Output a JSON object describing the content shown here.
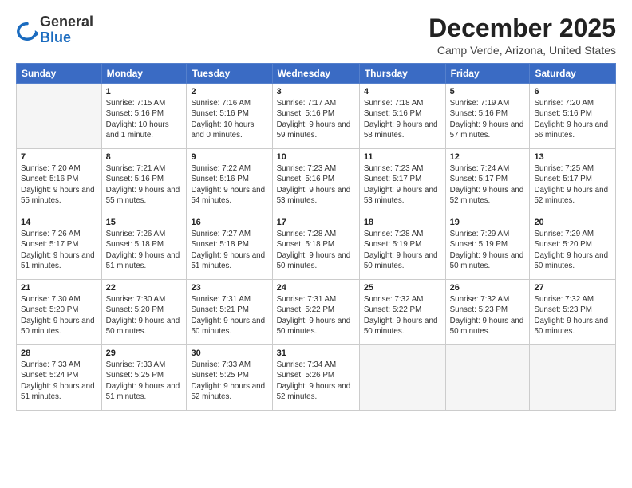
{
  "logo": {
    "general": "General",
    "blue": "Blue"
  },
  "title": "December 2025",
  "location": "Camp Verde, Arizona, United States",
  "days_of_week": [
    "Sunday",
    "Monday",
    "Tuesday",
    "Wednesday",
    "Thursday",
    "Friday",
    "Saturday"
  ],
  "weeks": [
    [
      {
        "day": "",
        "info": ""
      },
      {
        "day": "1",
        "info": "Sunrise: 7:15 AM\nSunset: 5:16 PM\nDaylight: 10 hours\nand 1 minute."
      },
      {
        "day": "2",
        "info": "Sunrise: 7:16 AM\nSunset: 5:16 PM\nDaylight: 10 hours\nand 0 minutes."
      },
      {
        "day": "3",
        "info": "Sunrise: 7:17 AM\nSunset: 5:16 PM\nDaylight: 9 hours\nand 59 minutes."
      },
      {
        "day": "4",
        "info": "Sunrise: 7:18 AM\nSunset: 5:16 PM\nDaylight: 9 hours\nand 58 minutes."
      },
      {
        "day": "5",
        "info": "Sunrise: 7:19 AM\nSunset: 5:16 PM\nDaylight: 9 hours\nand 57 minutes."
      },
      {
        "day": "6",
        "info": "Sunrise: 7:20 AM\nSunset: 5:16 PM\nDaylight: 9 hours\nand 56 minutes."
      }
    ],
    [
      {
        "day": "7",
        "info": "Sunrise: 7:20 AM\nSunset: 5:16 PM\nDaylight: 9 hours\nand 55 minutes."
      },
      {
        "day": "8",
        "info": "Sunrise: 7:21 AM\nSunset: 5:16 PM\nDaylight: 9 hours\nand 55 minutes."
      },
      {
        "day": "9",
        "info": "Sunrise: 7:22 AM\nSunset: 5:16 PM\nDaylight: 9 hours\nand 54 minutes."
      },
      {
        "day": "10",
        "info": "Sunrise: 7:23 AM\nSunset: 5:16 PM\nDaylight: 9 hours\nand 53 minutes."
      },
      {
        "day": "11",
        "info": "Sunrise: 7:23 AM\nSunset: 5:17 PM\nDaylight: 9 hours\nand 53 minutes."
      },
      {
        "day": "12",
        "info": "Sunrise: 7:24 AM\nSunset: 5:17 PM\nDaylight: 9 hours\nand 52 minutes."
      },
      {
        "day": "13",
        "info": "Sunrise: 7:25 AM\nSunset: 5:17 PM\nDaylight: 9 hours\nand 52 minutes."
      }
    ],
    [
      {
        "day": "14",
        "info": "Sunrise: 7:26 AM\nSunset: 5:17 PM\nDaylight: 9 hours\nand 51 minutes."
      },
      {
        "day": "15",
        "info": "Sunrise: 7:26 AM\nSunset: 5:18 PM\nDaylight: 9 hours\nand 51 minutes."
      },
      {
        "day": "16",
        "info": "Sunrise: 7:27 AM\nSunset: 5:18 PM\nDaylight: 9 hours\nand 51 minutes."
      },
      {
        "day": "17",
        "info": "Sunrise: 7:28 AM\nSunset: 5:18 PM\nDaylight: 9 hours\nand 50 minutes."
      },
      {
        "day": "18",
        "info": "Sunrise: 7:28 AM\nSunset: 5:19 PM\nDaylight: 9 hours\nand 50 minutes."
      },
      {
        "day": "19",
        "info": "Sunrise: 7:29 AM\nSunset: 5:19 PM\nDaylight: 9 hours\nand 50 minutes."
      },
      {
        "day": "20",
        "info": "Sunrise: 7:29 AM\nSunset: 5:20 PM\nDaylight: 9 hours\nand 50 minutes."
      }
    ],
    [
      {
        "day": "21",
        "info": "Sunrise: 7:30 AM\nSunset: 5:20 PM\nDaylight: 9 hours\nand 50 minutes."
      },
      {
        "day": "22",
        "info": "Sunrise: 7:30 AM\nSunset: 5:20 PM\nDaylight: 9 hours\nand 50 minutes."
      },
      {
        "day": "23",
        "info": "Sunrise: 7:31 AM\nSunset: 5:21 PM\nDaylight: 9 hours\nand 50 minutes."
      },
      {
        "day": "24",
        "info": "Sunrise: 7:31 AM\nSunset: 5:22 PM\nDaylight: 9 hours\nand 50 minutes."
      },
      {
        "day": "25",
        "info": "Sunrise: 7:32 AM\nSunset: 5:22 PM\nDaylight: 9 hours\nand 50 minutes."
      },
      {
        "day": "26",
        "info": "Sunrise: 7:32 AM\nSunset: 5:23 PM\nDaylight: 9 hours\nand 50 minutes."
      },
      {
        "day": "27",
        "info": "Sunrise: 7:32 AM\nSunset: 5:23 PM\nDaylight: 9 hours\nand 50 minutes."
      }
    ],
    [
      {
        "day": "28",
        "info": "Sunrise: 7:33 AM\nSunset: 5:24 PM\nDaylight: 9 hours\nand 51 minutes."
      },
      {
        "day": "29",
        "info": "Sunrise: 7:33 AM\nSunset: 5:25 PM\nDaylight: 9 hours\nand 51 minutes."
      },
      {
        "day": "30",
        "info": "Sunrise: 7:33 AM\nSunset: 5:25 PM\nDaylight: 9 hours\nand 52 minutes."
      },
      {
        "day": "31",
        "info": "Sunrise: 7:34 AM\nSunset: 5:26 PM\nDaylight: 9 hours\nand 52 minutes."
      },
      {
        "day": "",
        "info": ""
      },
      {
        "day": "",
        "info": ""
      },
      {
        "day": "",
        "info": ""
      }
    ]
  ]
}
